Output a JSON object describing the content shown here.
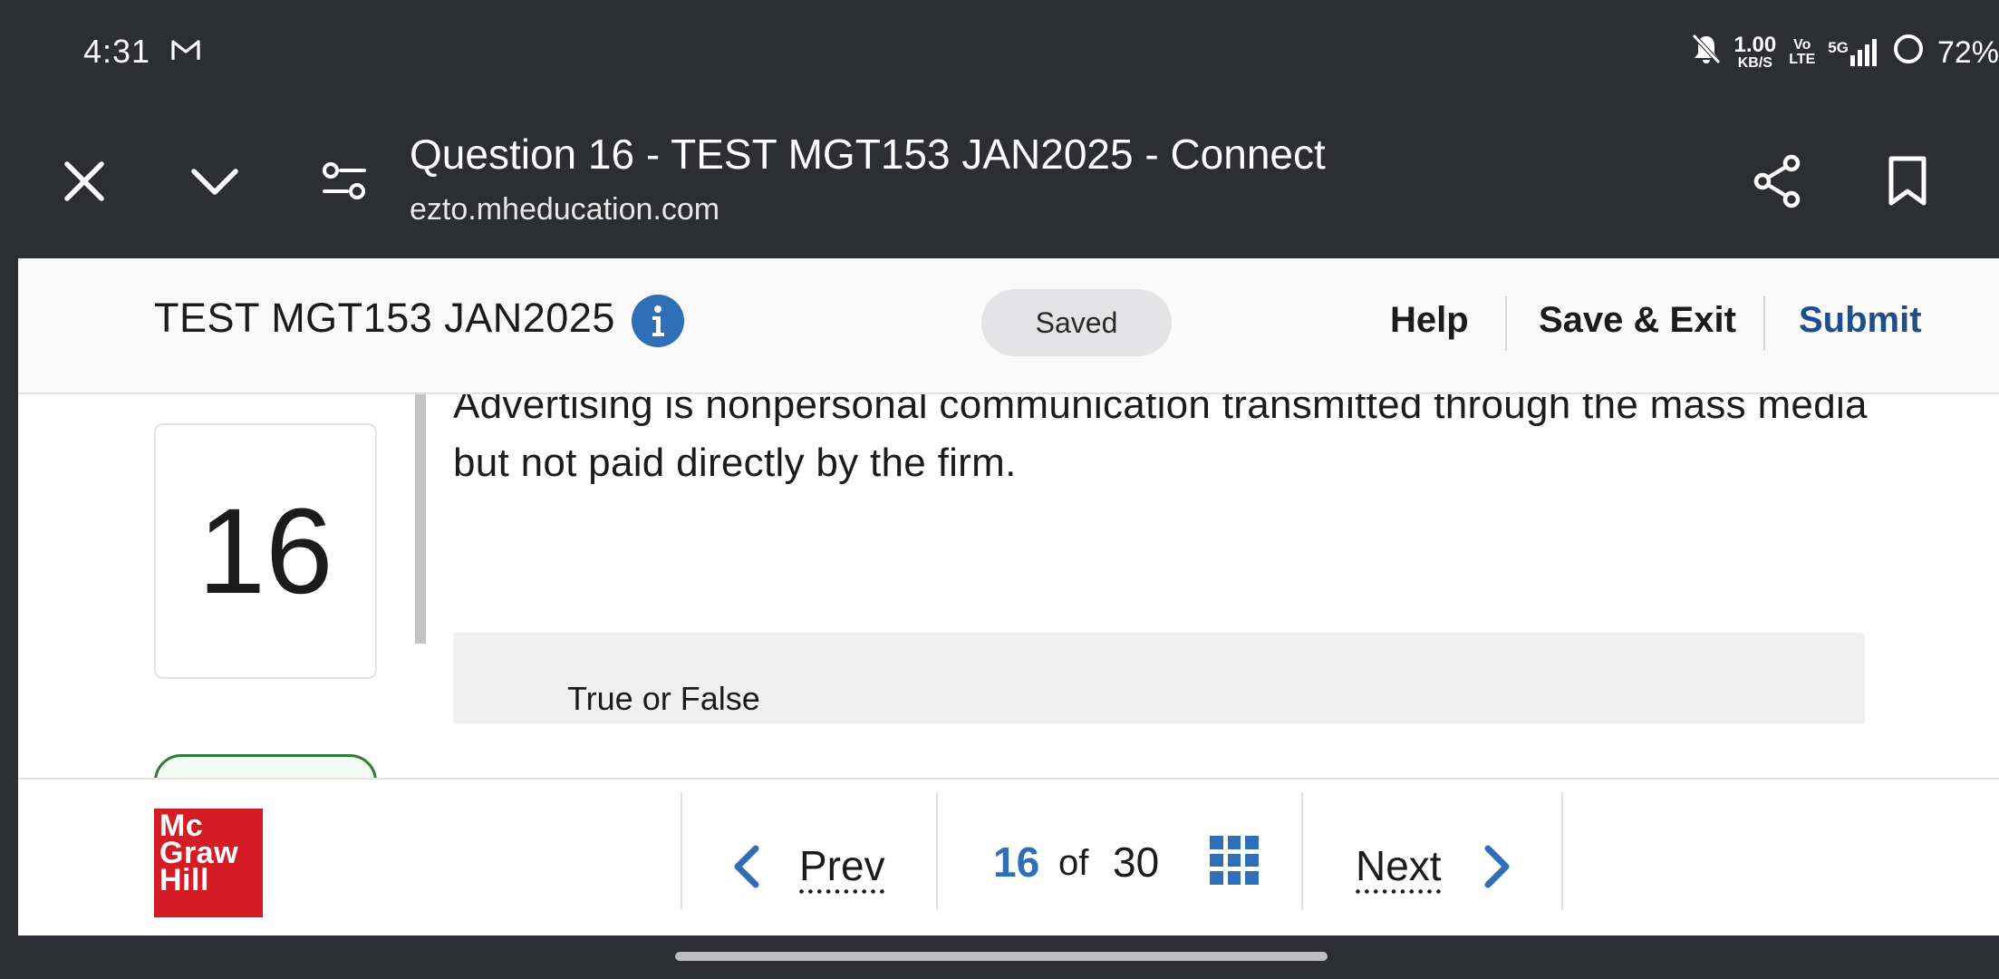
{
  "status_bar": {
    "time": "4:31",
    "net_speed_value": "1.00",
    "net_speed_unit": "KB/S",
    "volte_top": "Vo",
    "volte_bottom": "LTE",
    "network": "5G",
    "battery": "72%",
    "icons": [
      "gmail-icon",
      "mute-bell-icon",
      "signal-icon",
      "battery-ring-icon"
    ]
  },
  "browser": {
    "page_title": "Question 16 - TEST MGT153 JAN2025 - Connect",
    "url": "ezto.mheducation.com",
    "icons": [
      "close-icon",
      "chevron-down-icon",
      "site-settings-icon",
      "share-icon",
      "bookmark-icon"
    ]
  },
  "header": {
    "test_name": "TEST MGT153 JAN2025",
    "saved_status": "Saved",
    "help_label": "Help",
    "save_exit_label": "Save & Exit",
    "submit_label": "Submit",
    "accent_color": "#2f6fb8",
    "submit_color": "#1f4e8c"
  },
  "question": {
    "number": "16",
    "text": "Advertising is nonpersonal communication transmitted through the mass media but not paid directly by the firm.",
    "answer_type": "True or False"
  },
  "navigation": {
    "logo_line1": "Mc",
    "logo_line2": "Graw",
    "logo_line3": "Hill",
    "prev_label": "Prev",
    "next_label": "Next",
    "current_page": "16",
    "of_label": "of",
    "total_pages": "30",
    "logo_color": "#d31c23"
  }
}
